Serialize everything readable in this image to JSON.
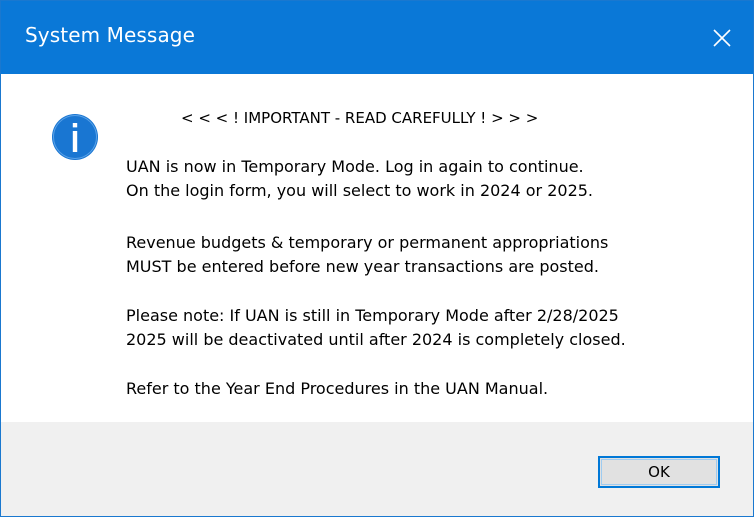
{
  "window": {
    "title": "System Message"
  },
  "icons": {
    "close": "close-icon",
    "info": "info-icon"
  },
  "message": {
    "heading": "< < < ! IMPORTANT - READ CAREFULLY ! > > >",
    "paragraphs": [
      [
        "UAN is now in Temporary Mode. Log in again to continue.",
        "On the login form, you will select to work in 2024 or 2025."
      ],
      [
        "Revenue budgets & temporary or permanent appropriations",
        "MUST be entered before new year transactions are posted."
      ],
      [
        "Please note: If UAN is still in Temporary Mode after 2/28/2025",
        "2025 will be deactivated until after 2024 is completely closed."
      ],
      [
        "Refer to the Year End Procedures in the UAN Manual."
      ]
    ]
  },
  "buttons": {
    "ok_label": "OK"
  },
  "colors": {
    "titlebar": "#0a78d7",
    "icon": "#1976d2",
    "footer": "#f0f0f0",
    "button_border": "#0078d7"
  }
}
